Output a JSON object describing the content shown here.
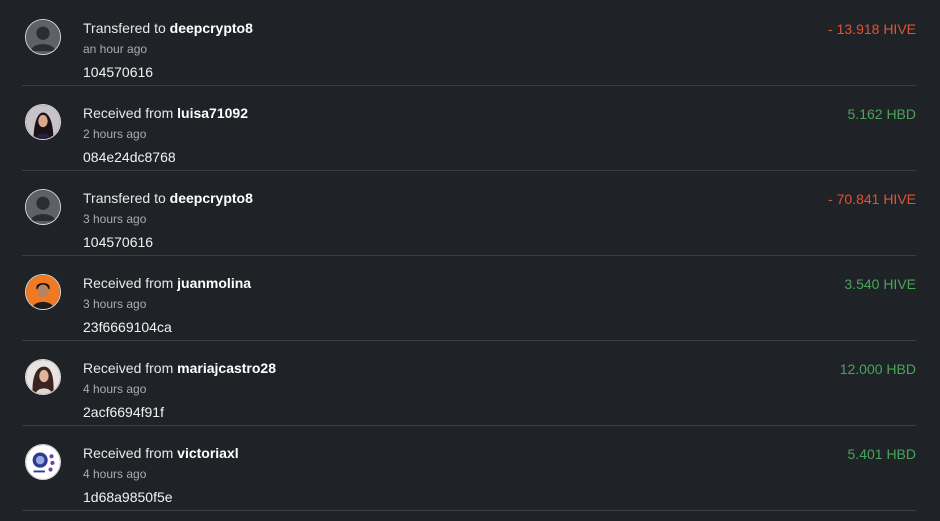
{
  "transactions": [
    {
      "action": "Transfered to",
      "user": "deepcrypto8",
      "time": "an hour ago",
      "memo": "104570616",
      "amount": "- 13.918 HIVE",
      "direction": "out",
      "avatar": "default-user-icon"
    },
    {
      "action": "Received from",
      "user": "luisa71092",
      "time": "2 hours ago",
      "memo": "084e24dc8768",
      "amount": "5.162 HBD",
      "direction": "in",
      "avatar": "user-photo"
    },
    {
      "action": "Transfered to",
      "user": "deepcrypto8",
      "time": "3 hours ago",
      "memo": "104570616",
      "amount": "- 70.841 HIVE",
      "direction": "out",
      "avatar": "default-user-icon"
    },
    {
      "action": "Received from",
      "user": "juanmolina",
      "time": "3 hours ago",
      "memo": "23f6669104ca",
      "amount": "3.540 HIVE",
      "direction": "in",
      "avatar": "user-photo"
    },
    {
      "action": "Received from",
      "user": "mariajcastro28",
      "time": "4 hours ago",
      "memo": "2acf6694f91f",
      "amount": "12.000 HBD",
      "direction": "in",
      "avatar": "user-photo"
    },
    {
      "action": "Received from",
      "user": "victoriaxl",
      "time": "4 hours ago",
      "memo": "1d68a9850f5e",
      "amount": "5.401 HBD",
      "direction": "in",
      "avatar": "user-logo"
    }
  ],
  "colors": {
    "background": "#1f2226",
    "divider": "#3a3d42",
    "outgoing": "#e2542f",
    "incoming": "#49a55a"
  }
}
